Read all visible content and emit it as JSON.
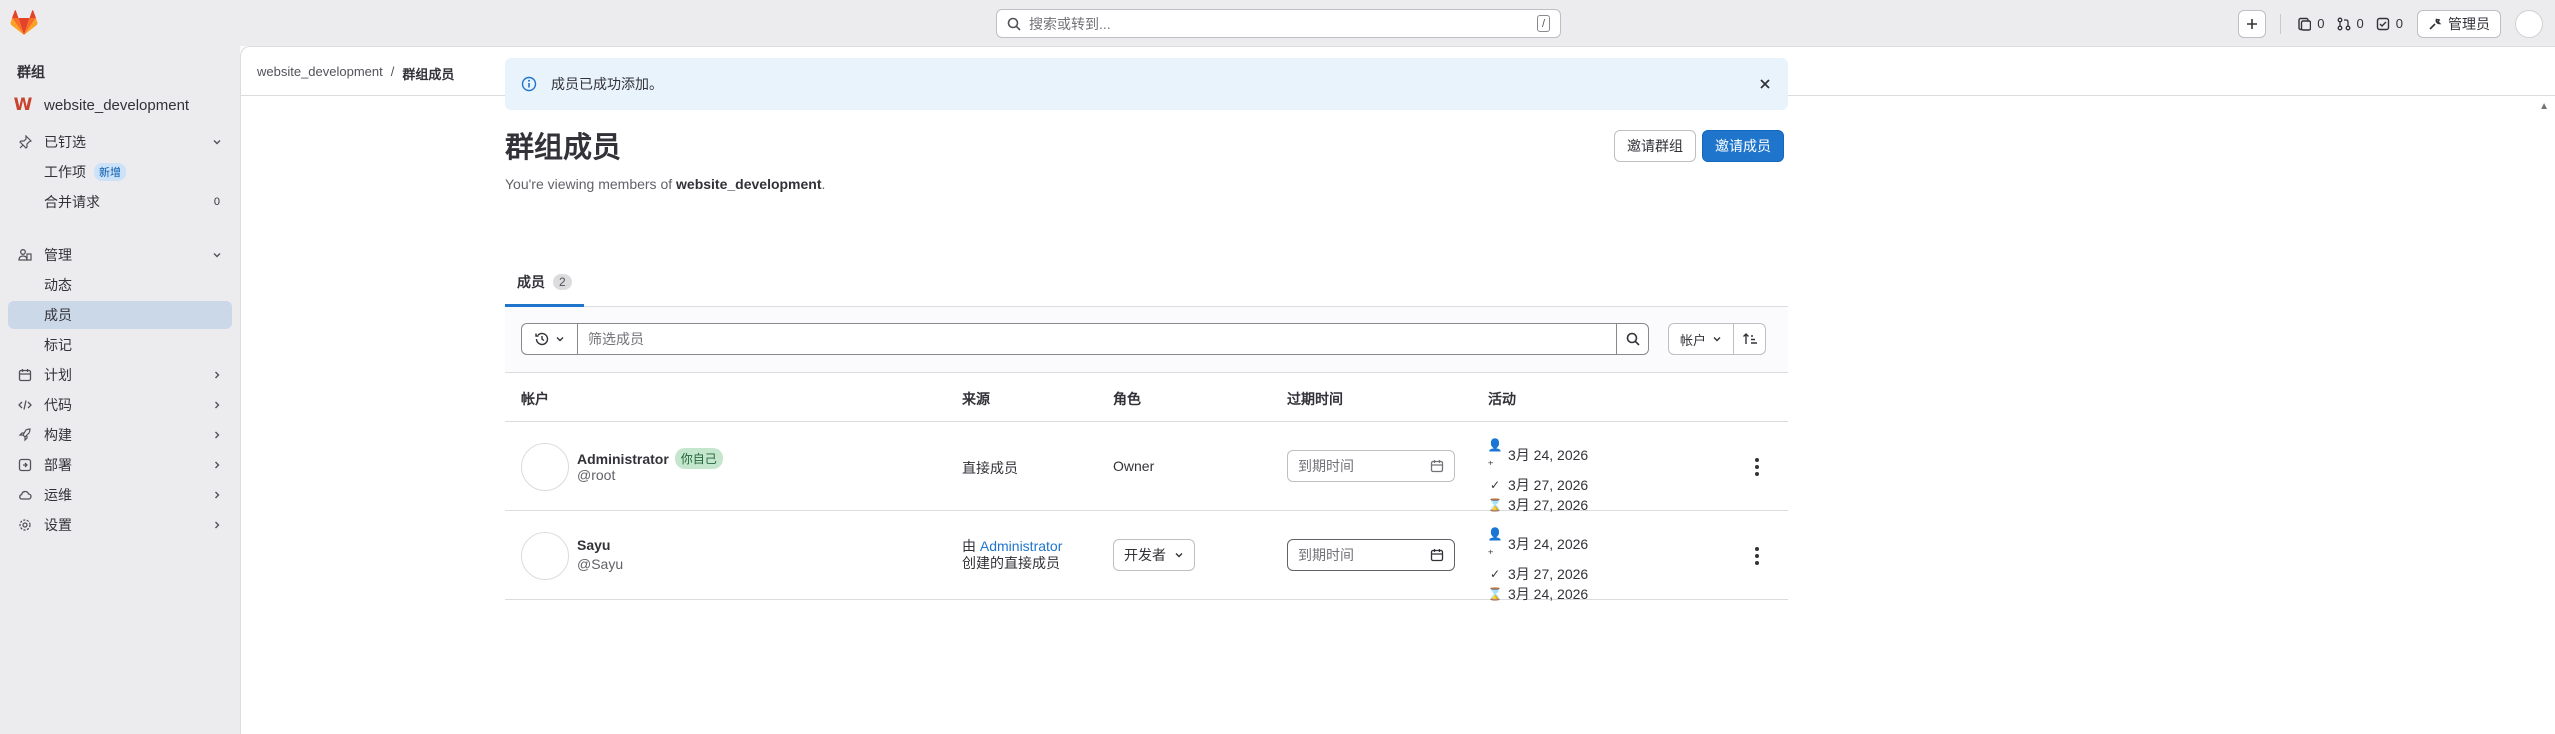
{
  "topbar": {
    "search_placeholder": "搜索或转到...",
    "search_shortcut": "/",
    "issues_count": "0",
    "mr_count": "0",
    "todo_count": "0",
    "admin_label": "管理员"
  },
  "sidebar": {
    "title": "群组",
    "group_initial": "W",
    "group_name": "website_development",
    "pinned": "已钉选",
    "work_items": "工作项",
    "new_badge": "新增",
    "merge_requests": "合并请求",
    "merge_requests_count": "0",
    "manage": "管理",
    "activity": "动态",
    "members": "成员",
    "labels": "标记",
    "plan": "计划",
    "code": "代码",
    "build": "构建",
    "deploy": "部署",
    "operate": "运维",
    "settings": "设置"
  },
  "breadcrumb": {
    "group": "website_development",
    "separator": "/",
    "current": "群组成员"
  },
  "alert": {
    "message": "成员已成功添加。"
  },
  "page": {
    "title": "群组成员",
    "subtitle_prefix": "You're viewing members of ",
    "subtitle_group": "website_development",
    "subtitle_suffix": ".",
    "invite_group": "邀请群组",
    "invite_members": "邀请成员"
  },
  "tabs": [
    {
      "label": "成员",
      "count": "2"
    }
  ],
  "filter": {
    "placeholder": "筛选成员",
    "sort_label": "帐户"
  },
  "table": {
    "headers": {
      "account": "帐户",
      "source": "来源",
      "role": "角色",
      "expiration": "过期时间",
      "activity": "活动"
    },
    "rows": [
      {
        "name": "Administrator",
        "badge": "你自己",
        "handle": "@root",
        "source": "直接成员",
        "role": "Owner",
        "expiration_placeholder": "到期时间",
        "activity": {
          "access_granted": "3月 24, 2026",
          "user_created": "3月 27, 2026",
          "last_activity": "3月 27, 2026"
        }
      },
      {
        "name": "Sayu",
        "handle": "@Sayu",
        "source_prefix": "由",
        "source_link": "Administrator",
        "source_suffix": "创建的直接成员",
        "role": "开发者",
        "expiration_placeholder": "到期时间",
        "activity": {
          "access_granted": "3月 24, 2026",
          "user_created": "3月 27, 2026",
          "last_activity": "3月 24, 2026"
        }
      }
    ]
  }
}
